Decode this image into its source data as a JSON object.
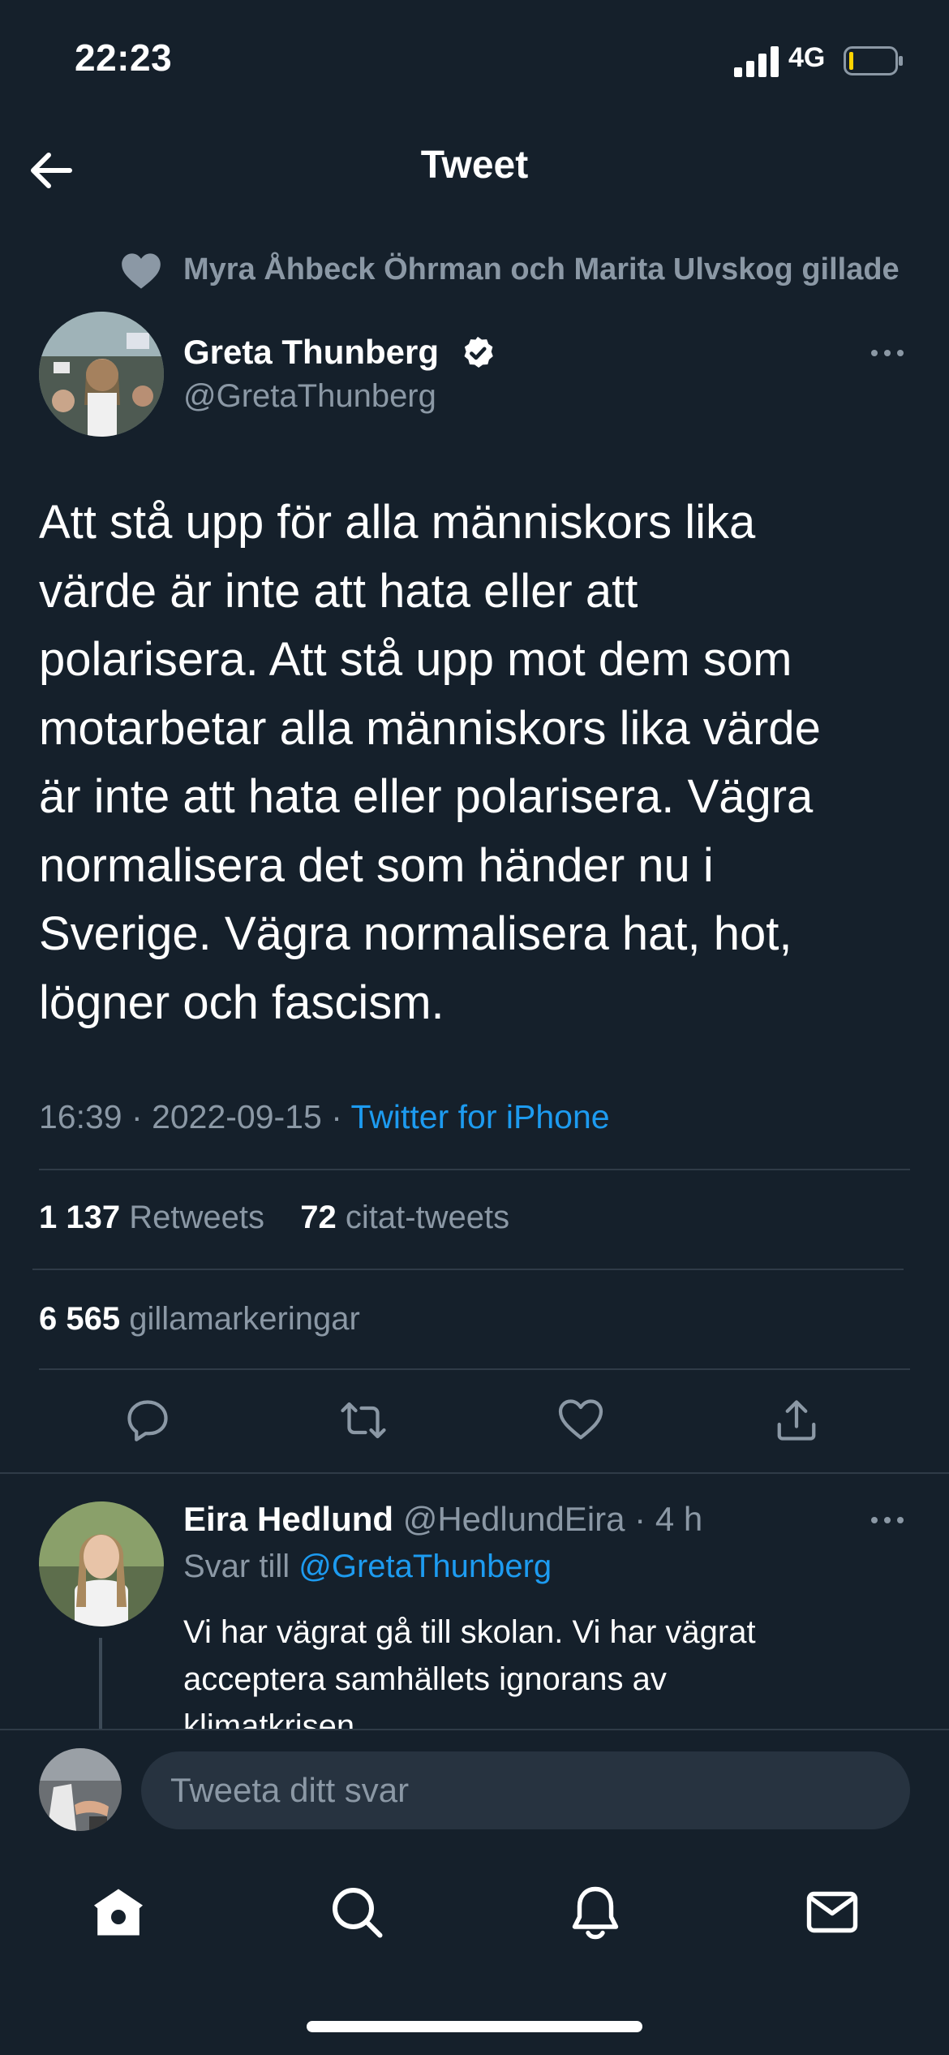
{
  "status_bar": {
    "time": "22:23",
    "network": "4G"
  },
  "header": {
    "title": "Tweet"
  },
  "social_context": {
    "text": "Myra Åhbeck Öhrman och Marita Ulvskog gillade"
  },
  "tweet": {
    "author_name": "Greta Thunberg",
    "author_handle": "@GretaThunberg",
    "text": "Att stå upp för alla människors lika\nvärde är inte att hata eller att\npolarisera. Att stå upp mot dem som\nmotarbetar alla människors lika värde\när inte att hata eller polarisera. Vägra\nnormalisera det som händer nu i\nSverige. Vägra normalisera hat, hot,\nlögner och fascism.",
    "time": "16:39",
    "date": "2022-09-15",
    "source": "Twitter for iPhone",
    "retweets_count": "1 137",
    "retweets_label": "Retweets",
    "quotes_count": "72",
    "quotes_label": "citat-tweets",
    "likes_count": "6 565",
    "likes_label": "gillamarkeringar"
  },
  "reply": {
    "author_name": "Eira Hedlund",
    "author_handle": "@HedlundEira",
    "age": "4 h",
    "reply_to_label": "Svar till",
    "reply_to_handle": "@GretaThunberg",
    "text": "Vi har vägrat gå till skolan. Vi har vägrat\nacceptera samhällets ignorans av\nklimatkrisen."
  },
  "composer": {
    "placeholder": "Tweeta ditt svar"
  },
  "icons": {
    "back": "arrow-left-icon",
    "liked": "heart-icon",
    "verified": "verified-badge-icon",
    "more": "more-horizontal-icon",
    "reply": "reply-icon",
    "retweet": "retweet-icon",
    "like": "like-icon",
    "share": "share-icon",
    "tabs": [
      "home-icon",
      "search-icon",
      "bell-icon",
      "mail-icon"
    ]
  },
  "colors": {
    "background": "#15202b",
    "accent": "#1d9bf0",
    "muted": "#8b98a5",
    "divider": "#2f3b47",
    "battery_low": "#ffd400"
  }
}
